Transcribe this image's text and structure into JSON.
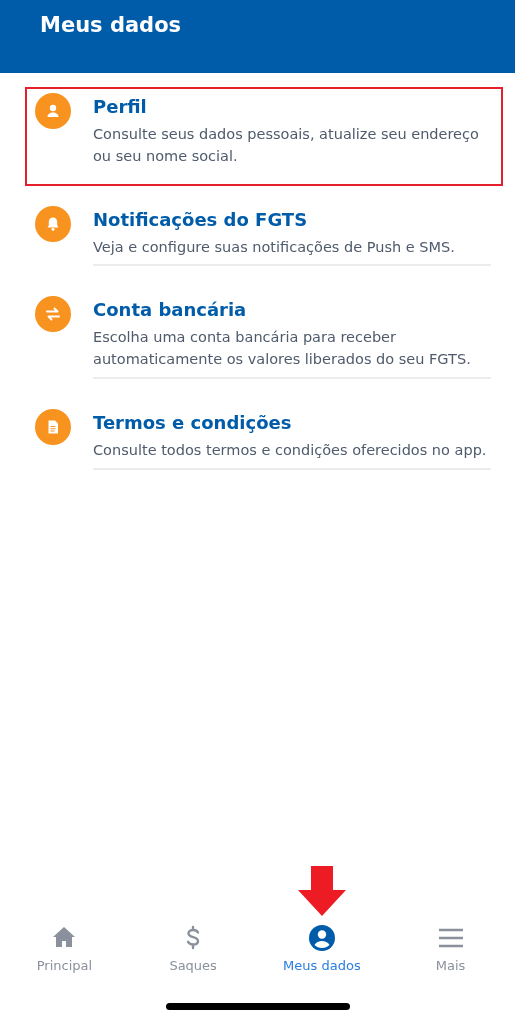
{
  "header": {
    "title": "Meus dados"
  },
  "items": [
    {
      "title": "Perfil",
      "description": "Consulte seus dados pessoais, atualize seu endereço ou seu nome social.",
      "highlighted": true
    },
    {
      "title": "Notificações do FGTS",
      "description": "Veja e configure suas notificações de Push e SMS.",
      "highlighted": false
    },
    {
      "title": "Conta bancária",
      "description": "Escolha uma conta bancária para receber automaticamente os valores liberados do seu FGTS.",
      "highlighted": false
    },
    {
      "title": "Termos e condições",
      "description": "Consulte todos termos e condições oferecidos no app.",
      "highlighted": false
    }
  ],
  "bottom_nav": [
    {
      "label": "Principal",
      "selected": false,
      "pointed": false
    },
    {
      "label": "Saques",
      "selected": false,
      "pointed": false
    },
    {
      "label": "Meus dados",
      "selected": true,
      "pointed": true
    },
    {
      "label": "Mais",
      "selected": false,
      "pointed": false
    }
  ]
}
